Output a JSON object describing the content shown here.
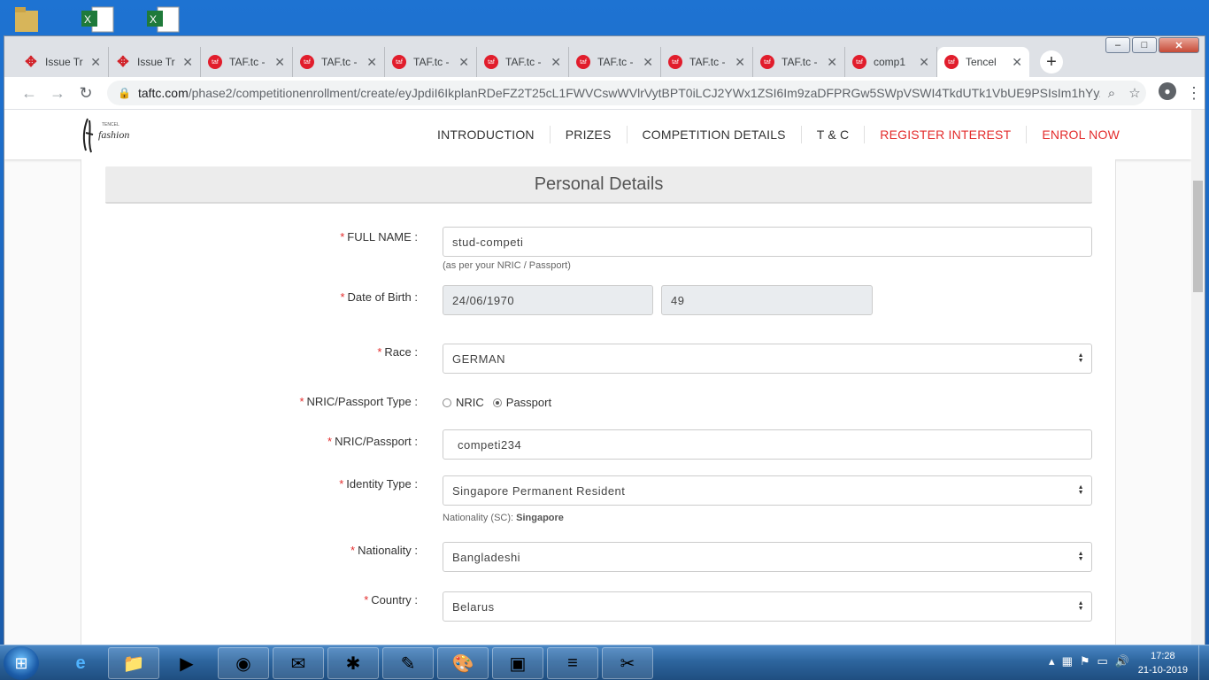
{
  "window": {
    "minimize": "–",
    "maximize": "□",
    "close": "✕"
  },
  "tabs": [
    {
      "label": "Issue Tr",
      "type": "issue"
    },
    {
      "label": "Issue Tr",
      "type": "issue"
    },
    {
      "label": "TAF.tc -",
      "type": "taf"
    },
    {
      "label": "TAF.tc -",
      "type": "taf"
    },
    {
      "label": "TAF.tc -",
      "type": "taf"
    },
    {
      "label": "TAF.tc -",
      "type": "taf"
    },
    {
      "label": "TAF.tc -",
      "type": "taf"
    },
    {
      "label": "TAF.tc -",
      "type": "taf"
    },
    {
      "label": "TAF.tc -",
      "type": "taf"
    },
    {
      "label": "comp1",
      "type": "taf"
    },
    {
      "label": "Tencel",
      "type": "taf",
      "active": true
    }
  ],
  "address": {
    "host": "taftc.com",
    "path": "/phase2/competitionenrollment/create/eyJpdiI6IkplanRDeFZ2T25cL1FWVCswWVlrVytBPT0iLCJ2YWx1ZSI6Im9zaDFPRGw5SWpVSWI4TkdUTk1VbUE9PSIsIm1hYy..."
  },
  "site_nav": {
    "items": [
      "INTRODUCTION",
      "PRIZES",
      "COMPETITION DETAILS",
      "T & C",
      "REGISTER INTEREST",
      "ENROL NOW"
    ]
  },
  "section_title": "Personal Details",
  "form": {
    "required_mark": "*",
    "full_name": {
      "label": "FULL NAME :",
      "value": "stud-competi",
      "help": "(as per your NRIC / Passport)"
    },
    "dob": {
      "label": "Date of Birth :",
      "value": "24/06/1970",
      "age": "49"
    },
    "race": {
      "label": "Race :",
      "value": "GERMAN"
    },
    "id_type_radio": {
      "label": "NRIC/Passport Type :",
      "options": [
        "NRIC",
        "Passport"
      ],
      "selected": "Passport"
    },
    "nric": {
      "label": "NRIC/Passport :",
      "value": "competi234"
    },
    "identity_type": {
      "label": "Identity Type :",
      "value": "Singapore Permanent Resident",
      "help_prefix": "Nationality (SC):",
      "help_value": "Singapore"
    },
    "nationality": {
      "label": "Nationality :",
      "value": "Bangladeshi"
    },
    "country": {
      "label": "Country :",
      "value": "Belarus"
    }
  },
  "taskbar": {
    "time": "17:28",
    "date": "21-10-2019"
  }
}
